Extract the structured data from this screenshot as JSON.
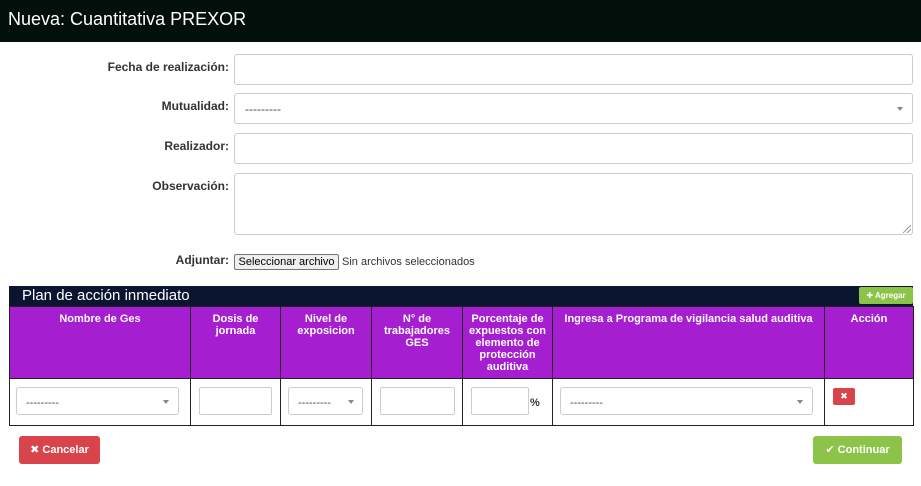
{
  "header": {
    "title": "Nueva: Cuantitativa PREXOR"
  },
  "form": {
    "fecha_label": "Fecha de realización:",
    "fecha_value": "",
    "mutualidad_label": "Mutualidad:",
    "mutualidad_value": "---------",
    "realizador_label": "Realizador:",
    "realizador_value": "",
    "observacion_label": "Observación:",
    "observacion_value": "",
    "adjuntar_label": "Adjuntar:",
    "file_button": "Seleccionar archivo",
    "file_status": "Sin archivos seleccionados"
  },
  "plan": {
    "title": "Plan de acción inmediato",
    "add_label": "Agregar",
    "columns": [
      "Nombre de Ges",
      "Dosis de jornada",
      "Nivel de exposicion",
      "N° de trabajadores GES",
      "Porcentaje de expuestos con elemento de protección auditiva",
      "Ingresa a Programa de vigilancia salud auditiva",
      "Acción"
    ],
    "row": {
      "ges_value": "---------",
      "nivel_value": "---------",
      "percent_symbol": "%",
      "programa_value": "---------"
    }
  },
  "actions": {
    "cancel_label": "Cancelar",
    "continue_label": "Continuar"
  },
  "colors": {
    "header_bg": "#030f0a",
    "plan_bar_bg": "#0c1530",
    "table_header_bg": "#a51fd0",
    "danger": "#d9434b",
    "success": "#8cc44a"
  },
  "icons": {
    "cancel": "times-icon",
    "continue": "check-icon",
    "add": "plus-icon",
    "delete": "times-icon"
  }
}
